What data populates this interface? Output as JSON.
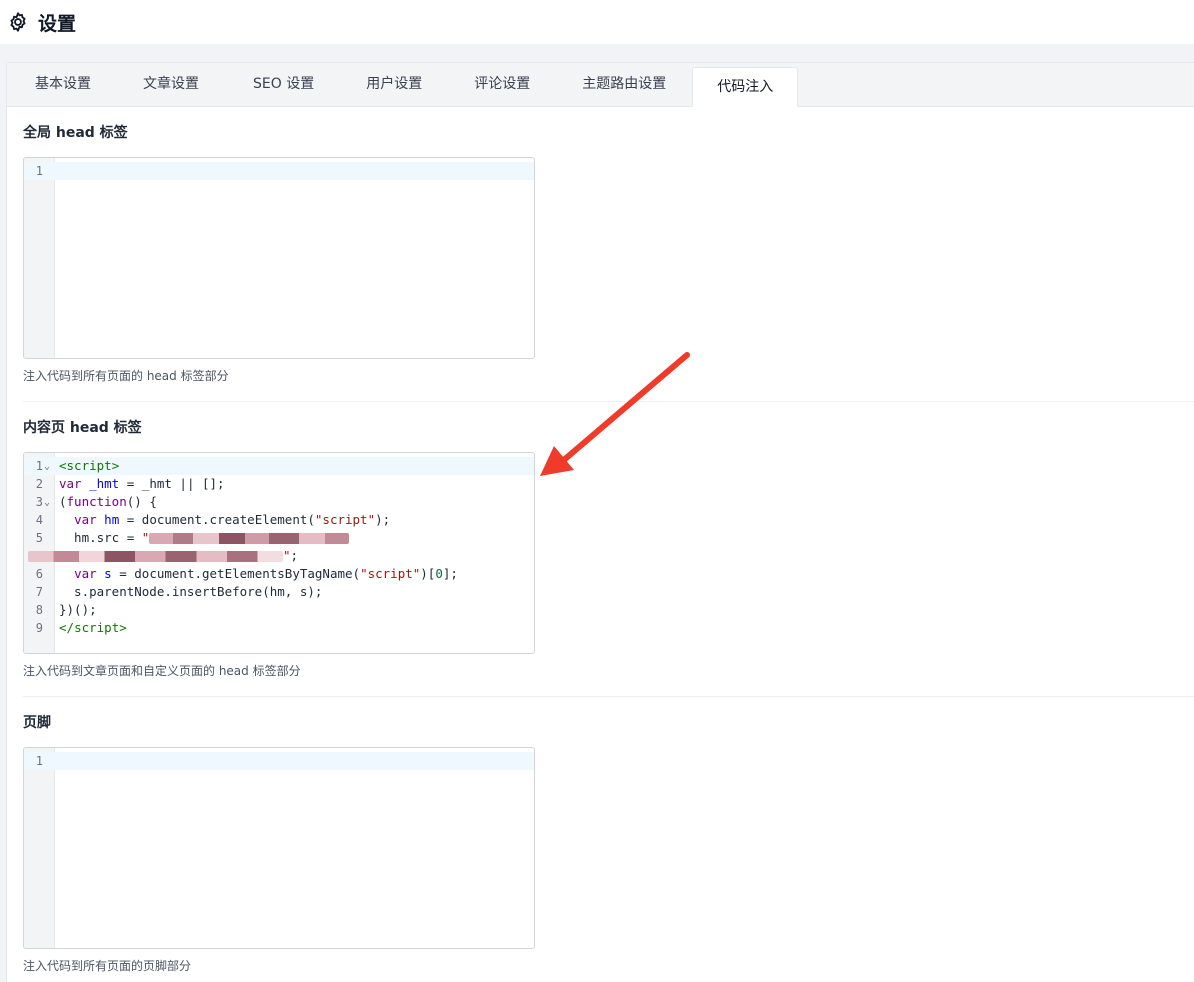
{
  "header": {
    "title": "设置",
    "icon": "gear-icon"
  },
  "tabs": [
    {
      "label": "基本设置",
      "active": false
    },
    {
      "label": "文章设置",
      "active": false
    },
    {
      "label": "SEO 设置",
      "active": false
    },
    {
      "label": "用户设置",
      "active": false
    },
    {
      "label": "评论设置",
      "active": false
    },
    {
      "label": "主题路由设置",
      "active": false
    },
    {
      "label": "代码注入",
      "active": true
    }
  ],
  "sections": {
    "global_head": {
      "label": "全局 head 标签",
      "help": "注入代码到所有页面的 head 标签部分",
      "line_numbers": [
        "1"
      ]
    },
    "content_head": {
      "label": "内容页 head 标签",
      "help": "注入代码到文章页面和自定义页面的 head 标签部分",
      "line_numbers": [
        "1",
        "2",
        "3",
        "4",
        "5",
        "6",
        "7",
        "8",
        "9"
      ],
      "code": {
        "l1_open": "<",
        "l1_tag": "script",
        "l1_close": ">",
        "l2_kw": "var",
        "l2_def": "_hmt",
        "l2_rest": " = _hmt || [];",
        "l3_open": "(",
        "l3_kw": "function",
        "l3_rest": "() {",
        "l4_kw": "var",
        "l4_def": "hm",
        "l4_mid": " = document.createElement(",
        "l4_str": "\"script\"",
        "l4_end": ");",
        "l5_lead": "  hm.src = ",
        "l5_str": "\"",
        "l5b_str": "\"",
        "l5b_end": ";",
        "l6_kw": "var",
        "l6_def": "s",
        "l6_mid": " = document.getElementsByTagName(",
        "l6_str": "\"script\"",
        "l6_num": "0",
        "l6_end": "];",
        "l7": "  s.parentNode.insertBefore(hm, s);",
        "l8": "})();",
        "l9_open": "</",
        "l9_tag": "script",
        "l9_close": ">"
      }
    },
    "footer": {
      "label": "页脚",
      "help": "注入代码到所有页面的页脚部分",
      "line_numbers": [
        "1"
      ]
    }
  },
  "colors": {
    "arrow": "#f03a2a",
    "tab_bar": "#f3f4f6",
    "page_bg": "#f1f3f7",
    "redaction": "#b06a7a"
  }
}
